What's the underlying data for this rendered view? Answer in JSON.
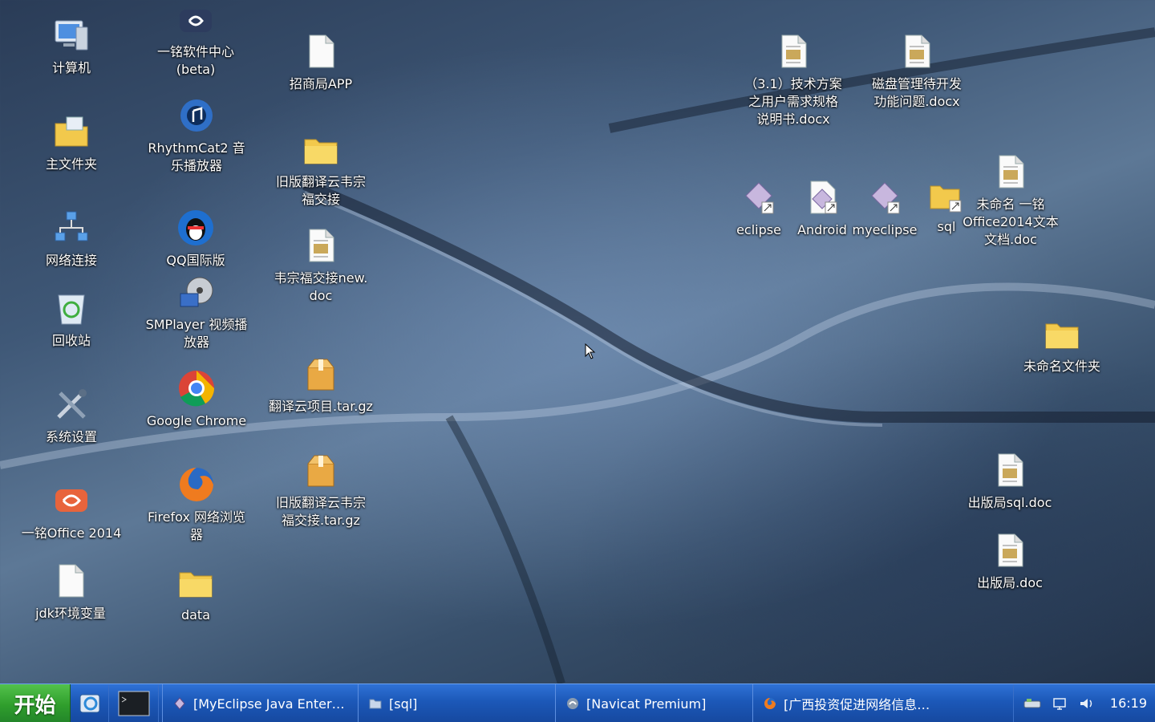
{
  "desktop": {
    "icons": [
      {
        "label": "计算机",
        "icon": "computer-icon"
      },
      {
        "label": "主文件夹",
        "icon": "home-folder-icon"
      },
      {
        "label": "网络连接",
        "icon": "network-icon"
      },
      {
        "label": "回收站",
        "icon": "recycle-bin-icon"
      },
      {
        "label": "系统设置",
        "icon": "settings-icon"
      },
      {
        "label": "一铭Office 2014",
        "icon": "office-icon"
      },
      {
        "label": "jdk环境变量",
        "icon": "blank-file-icon"
      },
      {
        "label": "一铭软件中心\n(beta)",
        "icon": "software-center-icon"
      },
      {
        "label": "RhythmCat2 音\n乐播放器",
        "icon": "music-player-icon"
      },
      {
        "label": "QQ国际版",
        "icon": "qq-icon"
      },
      {
        "label": "SMPlayer 视频播\n放器",
        "icon": "video-player-icon"
      },
      {
        "label": "Google Chrome",
        "icon": "chrome-icon"
      },
      {
        "label": "Firefox 网络浏览\n器",
        "icon": "firefox-icon"
      },
      {
        "label": "data",
        "icon": "folder-icon"
      },
      {
        "label": "招商局APP",
        "icon": "blank-file-icon"
      },
      {
        "label": "旧版翻译云韦宗\n福交接",
        "icon": "folder-icon"
      },
      {
        "label": "韦宗福交接new.\ndoc",
        "icon": "doc-file-icon"
      },
      {
        "label": "翻译云项目.tar.gz",
        "icon": "archive-icon"
      },
      {
        "label": "旧版翻译云韦宗\n福交接.tar.gz",
        "icon": "archive-icon"
      },
      {
        "label": "（3.1）技术方案\n之用户需求规格\n说明书.docx",
        "icon": "doc-file-icon"
      },
      {
        "label": "磁盘管理待开发\n功能问题.docx",
        "icon": "doc-file-icon"
      },
      {
        "label": "eclipse",
        "icon": "shortcut-icon"
      },
      {
        "label": "Android",
        "icon": "shortcut-icon"
      },
      {
        "label": "myeclipse",
        "icon": "shortcut-icon"
      },
      {
        "label": "sql",
        "icon": "folder-link-icon"
      },
      {
        "label": "未命名 一铭\nOffice2014文本\n文档.doc",
        "icon": "doc-file-icon"
      },
      {
        "label": "未命名文件夹",
        "icon": "folder-icon"
      },
      {
        "label": "出版局sql.doc",
        "icon": "doc-file-icon"
      },
      {
        "label": "出版局.doc",
        "icon": "doc-file-icon"
      }
    ]
  },
  "taskbar": {
    "start_label": "开始",
    "quick_launch": [
      "browser-launcher-icon",
      "terminal-icon"
    ],
    "tasks": [
      {
        "label": "[MyEclipse Java Enter…",
        "icon": "myeclipse-icon"
      },
      {
        "label": "[sql]",
        "icon": "folder-icon"
      },
      {
        "label": "[Navicat Premium]",
        "icon": "navicat-icon"
      },
      {
        "label": "[广西投资促进网络信息…",
        "icon": "firefox-icon"
      }
    ],
    "tray": [
      "network-status-icon",
      "display-icon",
      "volume-icon"
    ],
    "clock": "16:19"
  },
  "colors": {
    "taskbar": "#1c58b8",
    "start": "#2f9e2c",
    "folder": "#f2c94c"
  }
}
